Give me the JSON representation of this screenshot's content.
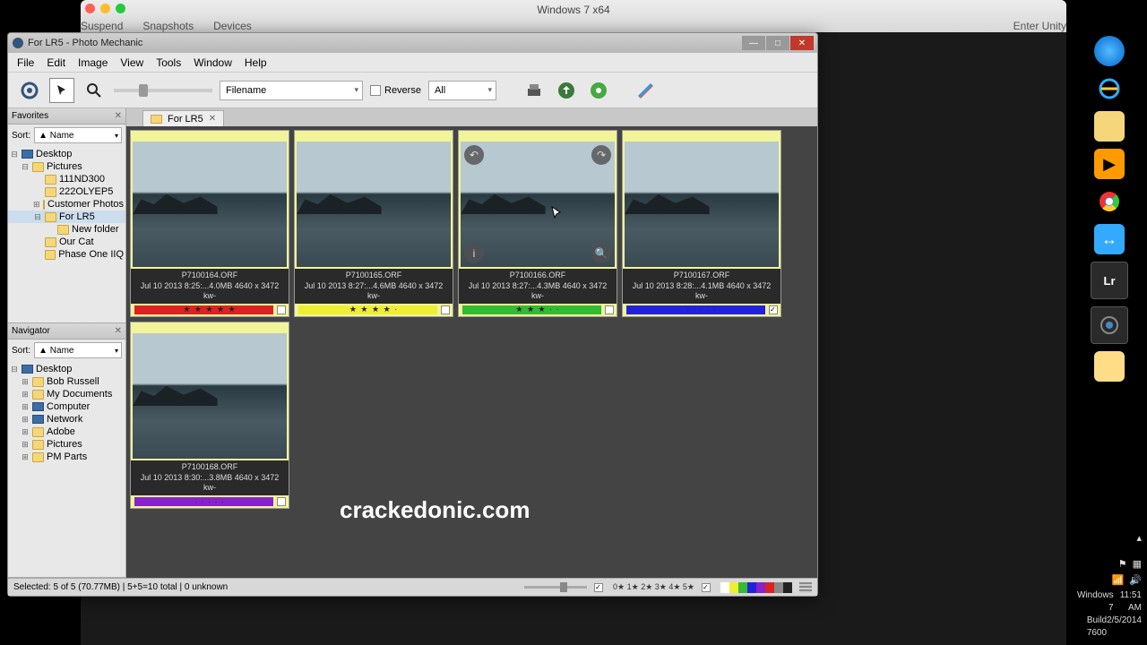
{
  "host": {
    "title": "Windows 7 x64",
    "menu": [
      "Suspend",
      "Snapshots",
      "Devices"
    ],
    "menu_right": "Enter Unity"
  },
  "systray": {
    "os_line1": "Windows 7",
    "os_line2": "Build 7600",
    "time": "11:51 AM",
    "date": "2/5/2014"
  },
  "app": {
    "title": "For LR5 - Photo Mechanic",
    "menu": [
      "File",
      "Edit",
      "Image",
      "View",
      "Tools",
      "Window",
      "Help"
    ],
    "toolbar": {
      "sort_field": "Filename",
      "reverse_label": "Reverse",
      "filter": "All"
    },
    "tab": {
      "label": "For LR5"
    },
    "favorites": {
      "title": "Favorites",
      "sort_label": "Sort:",
      "sort_value": "▲ Name",
      "tree": [
        {
          "label": "Desktop",
          "indent": 0,
          "exp": "⊟",
          "type": "desk"
        },
        {
          "label": "Pictures",
          "indent": 1,
          "exp": "⊟",
          "type": "fold"
        },
        {
          "label": "111ND300",
          "indent": 2,
          "exp": "",
          "type": "fold"
        },
        {
          "label": "222OLYEP5",
          "indent": 2,
          "exp": "",
          "type": "fold"
        },
        {
          "label": "Customer Photos",
          "indent": 2,
          "exp": "⊞",
          "type": "fold"
        },
        {
          "label": "For LR5",
          "indent": 2,
          "exp": "⊟",
          "type": "fold",
          "sel": true
        },
        {
          "label": "New folder",
          "indent": 3,
          "exp": "",
          "type": "fold"
        },
        {
          "label": "Our Cat",
          "indent": 2,
          "exp": "",
          "type": "fold"
        },
        {
          "label": "Phase One IIQ",
          "indent": 2,
          "exp": "",
          "type": "fold"
        }
      ]
    },
    "navigator": {
      "title": "Navigator",
      "sort_label": "Sort:",
      "sort_value": "▲ Name",
      "tree": [
        {
          "label": "Desktop",
          "indent": 0,
          "exp": "⊟",
          "type": "desk"
        },
        {
          "label": "Bob Russell",
          "indent": 1,
          "exp": "⊞",
          "type": "fold"
        },
        {
          "label": "My Documents",
          "indent": 1,
          "exp": "⊞",
          "type": "fold"
        },
        {
          "label": "Computer",
          "indent": 1,
          "exp": "⊞",
          "type": "desk"
        },
        {
          "label": "Network",
          "indent": 1,
          "exp": "⊞",
          "type": "desk"
        },
        {
          "label": "Adobe",
          "indent": 1,
          "exp": "⊞",
          "type": "fold"
        },
        {
          "label": "Pictures",
          "indent": 1,
          "exp": "⊞",
          "type": "fold"
        },
        {
          "label": "PM Parts",
          "indent": 1,
          "exp": "⊞",
          "type": "fold"
        }
      ]
    },
    "thumbs": [
      {
        "file": "P7100164.ORF",
        "meta": "Jul 10 2013 8:25:...4.0MB 4640 x 3472",
        "suffix": "kw-",
        "color": "#d22",
        "stars": "★ ★ ★ ★ ★",
        "checked": false,
        "active": false
      },
      {
        "file": "P7100165.ORF",
        "meta": "Jul 10 2013 8:27:...4.6MB 4640 x 3472",
        "suffix": "kw-",
        "color": "#ee3",
        "stars": "★ ★ ★ ★ ·",
        "checked": false,
        "active": false
      },
      {
        "file": "P7100166.ORF",
        "meta": "Jul 10 2013 8:27:...4.3MB 4640 x 3472",
        "suffix": "kw-",
        "color": "#3b3",
        "stars": "★ ★ ★ · ·",
        "checked": false,
        "active": true
      },
      {
        "file": "P7100167.ORF",
        "meta": "Jul 10 2013 8:28:...4.1MB 4640 x 3472",
        "suffix": "kw-",
        "color": "#22d",
        "stars": "· · · · ·",
        "checked": true,
        "active": false
      },
      {
        "file": "P7100168.ORF",
        "meta": "Jul 10 2013 8:30:...3.8MB 4640 x 3472",
        "suffix": "kw-",
        "color": "#82c",
        "stars": "· · · · ·",
        "checked": false,
        "active": false
      }
    ],
    "status": {
      "text": "Selected: 5 of 5 (70.77MB) | 5+5=10 total | 0 unknown",
      "star_filters": "0★ 1★ 2★ 3★ 4★ 5★"
    }
  },
  "watermark": "crackedonic.com"
}
